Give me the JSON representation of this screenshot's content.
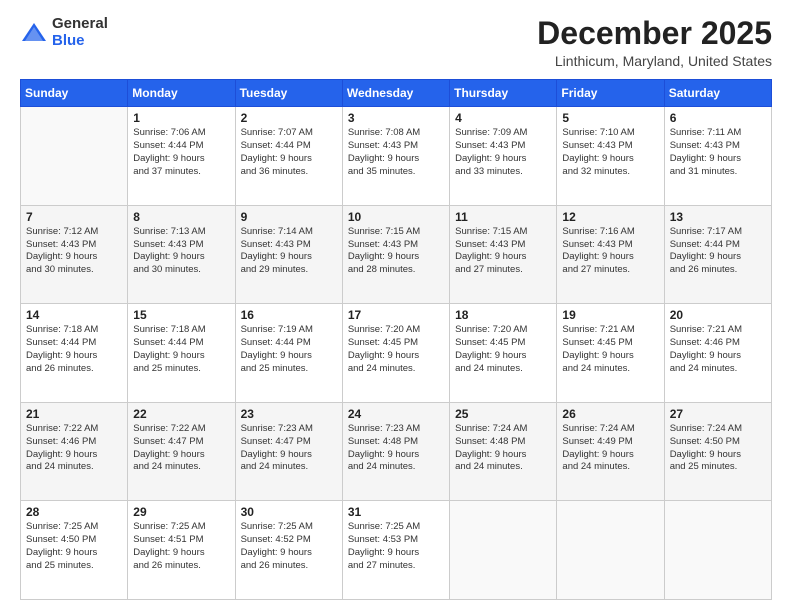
{
  "header": {
    "logo_general": "General",
    "logo_blue": "Blue",
    "month_title": "December 2025",
    "location": "Linthicum, Maryland, United States"
  },
  "days_of_week": [
    "Sunday",
    "Monday",
    "Tuesday",
    "Wednesday",
    "Thursday",
    "Friday",
    "Saturday"
  ],
  "weeks": [
    [
      {
        "day": "",
        "info": ""
      },
      {
        "day": "1",
        "info": "Sunrise: 7:06 AM\nSunset: 4:44 PM\nDaylight: 9 hours\nand 37 minutes."
      },
      {
        "day": "2",
        "info": "Sunrise: 7:07 AM\nSunset: 4:44 PM\nDaylight: 9 hours\nand 36 minutes."
      },
      {
        "day": "3",
        "info": "Sunrise: 7:08 AM\nSunset: 4:43 PM\nDaylight: 9 hours\nand 35 minutes."
      },
      {
        "day": "4",
        "info": "Sunrise: 7:09 AM\nSunset: 4:43 PM\nDaylight: 9 hours\nand 33 minutes."
      },
      {
        "day": "5",
        "info": "Sunrise: 7:10 AM\nSunset: 4:43 PM\nDaylight: 9 hours\nand 32 minutes."
      },
      {
        "day": "6",
        "info": "Sunrise: 7:11 AM\nSunset: 4:43 PM\nDaylight: 9 hours\nand 31 minutes."
      }
    ],
    [
      {
        "day": "7",
        "info": "Sunrise: 7:12 AM\nSunset: 4:43 PM\nDaylight: 9 hours\nand 30 minutes."
      },
      {
        "day": "8",
        "info": "Sunrise: 7:13 AM\nSunset: 4:43 PM\nDaylight: 9 hours\nand 30 minutes."
      },
      {
        "day": "9",
        "info": "Sunrise: 7:14 AM\nSunset: 4:43 PM\nDaylight: 9 hours\nand 29 minutes."
      },
      {
        "day": "10",
        "info": "Sunrise: 7:15 AM\nSunset: 4:43 PM\nDaylight: 9 hours\nand 28 minutes."
      },
      {
        "day": "11",
        "info": "Sunrise: 7:15 AM\nSunset: 4:43 PM\nDaylight: 9 hours\nand 27 minutes."
      },
      {
        "day": "12",
        "info": "Sunrise: 7:16 AM\nSunset: 4:43 PM\nDaylight: 9 hours\nand 27 minutes."
      },
      {
        "day": "13",
        "info": "Sunrise: 7:17 AM\nSunset: 4:44 PM\nDaylight: 9 hours\nand 26 minutes."
      }
    ],
    [
      {
        "day": "14",
        "info": "Sunrise: 7:18 AM\nSunset: 4:44 PM\nDaylight: 9 hours\nand 26 minutes."
      },
      {
        "day": "15",
        "info": "Sunrise: 7:18 AM\nSunset: 4:44 PM\nDaylight: 9 hours\nand 25 minutes."
      },
      {
        "day": "16",
        "info": "Sunrise: 7:19 AM\nSunset: 4:44 PM\nDaylight: 9 hours\nand 25 minutes."
      },
      {
        "day": "17",
        "info": "Sunrise: 7:20 AM\nSunset: 4:45 PM\nDaylight: 9 hours\nand 24 minutes."
      },
      {
        "day": "18",
        "info": "Sunrise: 7:20 AM\nSunset: 4:45 PM\nDaylight: 9 hours\nand 24 minutes."
      },
      {
        "day": "19",
        "info": "Sunrise: 7:21 AM\nSunset: 4:45 PM\nDaylight: 9 hours\nand 24 minutes."
      },
      {
        "day": "20",
        "info": "Sunrise: 7:21 AM\nSunset: 4:46 PM\nDaylight: 9 hours\nand 24 minutes."
      }
    ],
    [
      {
        "day": "21",
        "info": "Sunrise: 7:22 AM\nSunset: 4:46 PM\nDaylight: 9 hours\nand 24 minutes."
      },
      {
        "day": "22",
        "info": "Sunrise: 7:22 AM\nSunset: 4:47 PM\nDaylight: 9 hours\nand 24 minutes."
      },
      {
        "day": "23",
        "info": "Sunrise: 7:23 AM\nSunset: 4:47 PM\nDaylight: 9 hours\nand 24 minutes."
      },
      {
        "day": "24",
        "info": "Sunrise: 7:23 AM\nSunset: 4:48 PM\nDaylight: 9 hours\nand 24 minutes."
      },
      {
        "day": "25",
        "info": "Sunrise: 7:24 AM\nSunset: 4:48 PM\nDaylight: 9 hours\nand 24 minutes."
      },
      {
        "day": "26",
        "info": "Sunrise: 7:24 AM\nSunset: 4:49 PM\nDaylight: 9 hours\nand 24 minutes."
      },
      {
        "day": "27",
        "info": "Sunrise: 7:24 AM\nSunset: 4:50 PM\nDaylight: 9 hours\nand 25 minutes."
      }
    ],
    [
      {
        "day": "28",
        "info": "Sunrise: 7:25 AM\nSunset: 4:50 PM\nDaylight: 9 hours\nand 25 minutes."
      },
      {
        "day": "29",
        "info": "Sunrise: 7:25 AM\nSunset: 4:51 PM\nDaylight: 9 hours\nand 26 minutes."
      },
      {
        "day": "30",
        "info": "Sunrise: 7:25 AM\nSunset: 4:52 PM\nDaylight: 9 hours\nand 26 minutes."
      },
      {
        "day": "31",
        "info": "Sunrise: 7:25 AM\nSunset: 4:53 PM\nDaylight: 9 hours\nand 27 minutes."
      },
      {
        "day": "",
        "info": ""
      },
      {
        "day": "",
        "info": ""
      },
      {
        "day": "",
        "info": ""
      }
    ]
  ]
}
